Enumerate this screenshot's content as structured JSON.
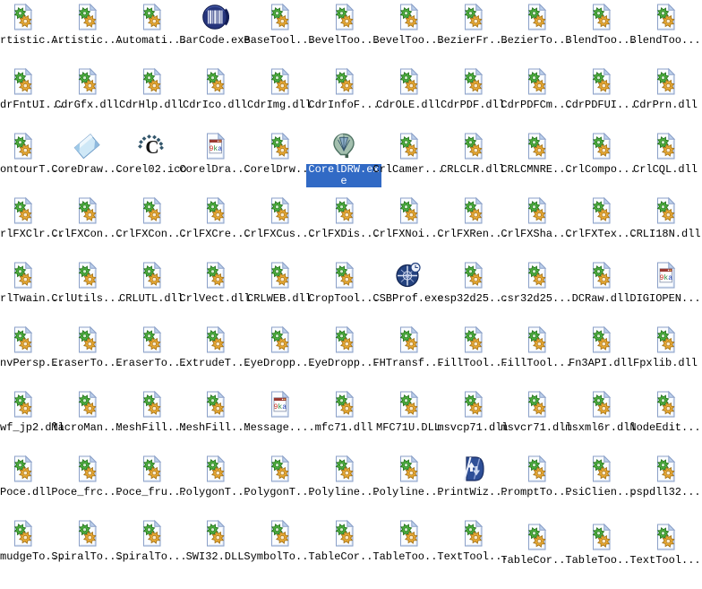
{
  "view": {
    "type": "explorer-icon-grid",
    "columns": 11,
    "rows": 9,
    "item_count": 99
  },
  "colors": {
    "background": "#ffffff",
    "label_text": "#000000",
    "selection_bg": "#316ac5",
    "selection_text": "#ffffff"
  },
  "items": [
    {
      "label": "rtistic...",
      "icon": "dll-file-icon",
      "clip_left": true
    },
    {
      "label": "Artistic...",
      "icon": "dll-file-icon"
    },
    {
      "label": "Automati...",
      "icon": "dll-file-icon"
    },
    {
      "label": "BarCode.exe",
      "icon": "barcode-icon"
    },
    {
      "label": "BaseTool...",
      "icon": "dll-file-icon"
    },
    {
      "label": "BevelToo...",
      "icon": "dll-file-icon"
    },
    {
      "label": "BevelToo...",
      "icon": "dll-file-icon"
    },
    {
      "label": "BezierFr...",
      "icon": "dll-file-icon"
    },
    {
      "label": "BezierTo...",
      "icon": "dll-file-icon"
    },
    {
      "label": "BlendToo...",
      "icon": "dll-file-icon"
    },
    {
      "label": "BlendToo...",
      "icon": "dll-file-icon"
    },
    {
      "label": "drFntUI...",
      "icon": "dll-file-icon",
      "clip_left": true
    },
    {
      "label": "CdrGfx.dll",
      "icon": "dll-file-icon"
    },
    {
      "label": "CdrHlp.dll",
      "icon": "dll-file-icon"
    },
    {
      "label": "CdrIco.dll",
      "icon": "dll-file-icon"
    },
    {
      "label": "CdrImg.dll",
      "icon": "dll-file-icon"
    },
    {
      "label": "CdrInfoF...",
      "icon": "dll-file-icon"
    },
    {
      "label": "CdrOLE.dll",
      "icon": "dll-file-icon"
    },
    {
      "label": "CdrPDF.dll",
      "icon": "dll-file-icon"
    },
    {
      "label": "CdrPDFCm...",
      "icon": "dll-file-icon"
    },
    {
      "label": "CdrPDFUI...",
      "icon": "dll-file-icon"
    },
    {
      "label": "CdrPrn.dll",
      "icon": "dll-file-icon"
    },
    {
      "label": "ontourT...",
      "icon": "dll-file-icon",
      "clip_left": true
    },
    {
      "label": "CoreDraw...",
      "icon": "tilted-photo-icon"
    },
    {
      "label": "Corel02.ico",
      "icon": "corel-logo-icon"
    },
    {
      "label": "CorelDra...",
      "icon": "app-document-icon"
    },
    {
      "label": "CorelDrw...",
      "icon": "dll-file-icon"
    },
    {
      "label": "CorelDRW.ex",
      "label2": "e",
      "icon": "corel-balloon-icon",
      "selected": true
    },
    {
      "label": "CrlCamer...",
      "icon": "dll-file-icon"
    },
    {
      "label": "CRLCLR.dll",
      "icon": "dll-file-icon"
    },
    {
      "label": "CRLCMNRE...",
      "icon": "dll-file-icon"
    },
    {
      "label": "CrlCompo...",
      "icon": "dll-file-icon"
    },
    {
      "label": "CrlCQL.dll",
      "icon": "dll-file-icon"
    },
    {
      "label": "rlFXClr...",
      "icon": "dll-file-icon",
      "clip_left": true
    },
    {
      "label": "CrlFXCon...",
      "icon": "dll-file-icon"
    },
    {
      "label": "CrlFXCon...",
      "icon": "dll-file-icon"
    },
    {
      "label": "CrlFXCre...",
      "icon": "dll-file-icon"
    },
    {
      "label": "CrlFXCus...",
      "icon": "dll-file-icon"
    },
    {
      "label": "CrlFXDis...",
      "icon": "dll-file-icon"
    },
    {
      "label": "CrlFXNoi...",
      "icon": "dll-file-icon"
    },
    {
      "label": "CrlFXRen...",
      "icon": "dll-file-icon"
    },
    {
      "label": "CrlFXSha...",
      "icon": "dll-file-icon"
    },
    {
      "label": "CrlFXTex...",
      "icon": "dll-file-icon"
    },
    {
      "label": "CRLI18N.dll",
      "icon": "dll-file-icon"
    },
    {
      "label": "rlTwain...",
      "icon": "dll-file-icon",
      "clip_left": true
    },
    {
      "label": "CrlUtils...",
      "icon": "dll-file-icon"
    },
    {
      "label": "CRLUTL.dll",
      "icon": "dll-file-icon"
    },
    {
      "label": "CrlVect.dll",
      "icon": "dll-file-icon"
    },
    {
      "label": "CRLWEB.dll",
      "icon": "dll-file-icon"
    },
    {
      "label": "CropTool...",
      "icon": "dll-file-icon"
    },
    {
      "label": "CSBProf.exe",
      "icon": "compass-globe-icon"
    },
    {
      "label": "csp32d25...",
      "icon": "dll-file-icon"
    },
    {
      "label": "csr32d25...",
      "icon": "dll-file-icon"
    },
    {
      "label": "DCRaw.dll",
      "icon": "dll-file-icon"
    },
    {
      "label": "DIGIOPEN...",
      "icon": "app-document-icon"
    },
    {
      "label": "nvPersp...",
      "icon": "dll-file-icon",
      "clip_left": true
    },
    {
      "label": "EraserTo...",
      "icon": "dll-file-icon"
    },
    {
      "label": "EraserTo...",
      "icon": "dll-file-icon"
    },
    {
      "label": "ExtrudeT...",
      "icon": "dll-file-icon"
    },
    {
      "label": "EyeDropp...",
      "icon": "dll-file-icon"
    },
    {
      "label": "EyeDropp...",
      "icon": "dll-file-icon"
    },
    {
      "label": "FHTransf...",
      "icon": "dll-file-icon"
    },
    {
      "label": "FillTool...",
      "icon": "dll-file-icon"
    },
    {
      "label": "FillTool...",
      "icon": "dll-file-icon"
    },
    {
      "label": "Fn3API.dll",
      "icon": "dll-file-icon"
    },
    {
      "label": "Fpxlib.dll",
      "icon": "dll-file-icon"
    },
    {
      "label": "wf_jp2.dll",
      "icon": "dll-file-icon",
      "clip_left": true
    },
    {
      "label": "MacroMan...",
      "icon": "dll-file-icon"
    },
    {
      "label": "MeshFill...",
      "icon": "dll-file-icon"
    },
    {
      "label": "MeshFill...",
      "icon": "dll-file-icon"
    },
    {
      "label": "Message....",
      "icon": "app-document-icon"
    },
    {
      "label": "mfc71.dll",
      "icon": "dll-file-icon"
    },
    {
      "label": "MFC71U.DLL",
      "icon": "dll-file-icon"
    },
    {
      "label": "msvcp71.dll",
      "icon": "dll-file-icon"
    },
    {
      "label": "msvcr71.dll",
      "icon": "dll-file-icon"
    },
    {
      "label": "msxml6r.dll",
      "icon": "dll-file-icon"
    },
    {
      "label": "NodeEdit...",
      "icon": "dll-file-icon"
    },
    {
      "label": "Poce.dll",
      "icon": "dll-file-icon",
      "clip_left": true
    },
    {
      "label": "Poce_frc...",
      "icon": "dll-file-icon"
    },
    {
      "label": "Poce_fru...",
      "icon": "dll-file-icon"
    },
    {
      "label": "PolygonT...",
      "icon": "dll-file-icon"
    },
    {
      "label": "PolygonT...",
      "icon": "dll-file-icon"
    },
    {
      "label": "Polyline...",
      "icon": "dll-file-icon"
    },
    {
      "label": "Polyline...",
      "icon": "dll-file-icon"
    },
    {
      "label": "PrintWiz...",
      "icon": "print-wizard-icon"
    },
    {
      "label": "PromptTo...",
      "icon": "dll-file-icon"
    },
    {
      "label": "PsiClien...",
      "icon": "dll-file-icon"
    },
    {
      "label": "pspdll32...",
      "icon": "dll-file-icon"
    },
    {
      "label": "mudgeTo...",
      "icon": "dll-file-icon",
      "clip_left": true
    },
    {
      "label": "SpiralTo...",
      "icon": "dll-file-icon"
    },
    {
      "label": "SpiralTo...",
      "icon": "dll-file-icon"
    },
    {
      "label": "SWI32.DLL",
      "icon": "dll-file-icon"
    },
    {
      "label": "SymbolTo...",
      "icon": "dll-file-icon"
    },
    {
      "label": "TableCor...",
      "icon": "dll-file-icon"
    },
    {
      "label": "TableToo...",
      "icon": "dll-file-icon"
    },
    {
      "label": "TextTool...",
      "icon": "dll-file-icon"
    },
    {
      "label": "TableCor...",
      "icon": "dll-file-icon",
      "shift_down": true
    },
    {
      "label": "TableToo...",
      "icon": "dll-file-icon",
      "shift_down": true
    },
    {
      "label": "TextTool...",
      "icon": "dll-file-icon",
      "shift_down": true
    }
  ]
}
